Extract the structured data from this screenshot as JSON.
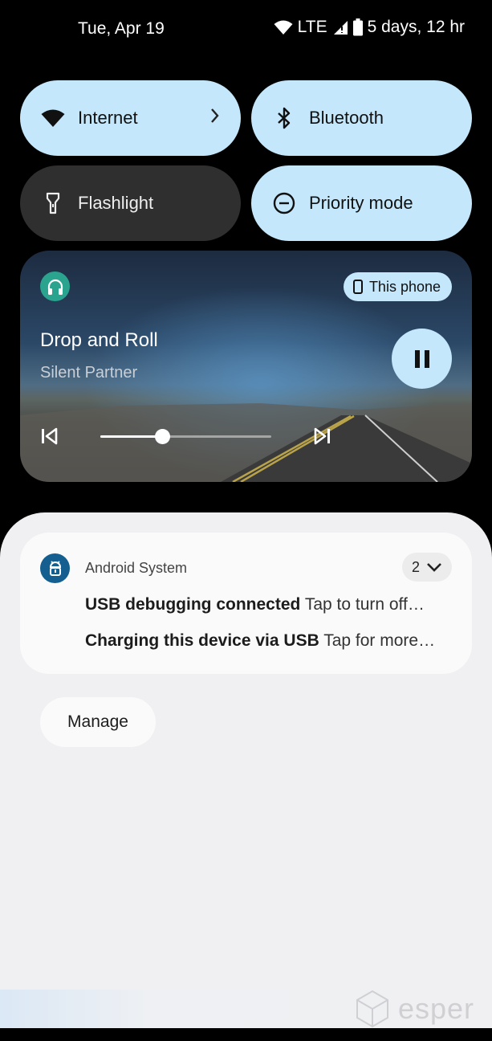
{
  "status_bar": {
    "date": "Tue, Apr 19",
    "network": "LTE",
    "battery": "5 days, 12 hr"
  },
  "quick_tiles": [
    {
      "label": "Internet",
      "icon": "wifi-icon",
      "state": "on"
    },
    {
      "label": "Bluetooth",
      "icon": "bluetooth-icon",
      "state": "on"
    },
    {
      "label": "Flashlight",
      "icon": "flashlight-icon",
      "state": "off"
    },
    {
      "label": "Priority mode",
      "icon": "do-not-disturb-icon",
      "state": "on"
    }
  ],
  "media": {
    "output_device": "This phone",
    "title": "Drop and Roll",
    "artist": "Silent Partner",
    "progress": 0.36
  },
  "notification": {
    "app_name": "Android System",
    "count": "2",
    "items": [
      {
        "title": "USB debugging connected",
        "text": "Tap to turn off…"
      },
      {
        "title": "Charging this device via USB",
        "text": "Tap for more…"
      }
    ]
  },
  "manage_label": "Manage",
  "watermark": "esper",
  "colors": {
    "tile_active": "#c4e7fb",
    "tile_inactive": "#2f2f2f",
    "shade_bg": "#f0f0f2",
    "media_app_icon": "#2aa48f",
    "system_app_icon": "#145f8f"
  }
}
